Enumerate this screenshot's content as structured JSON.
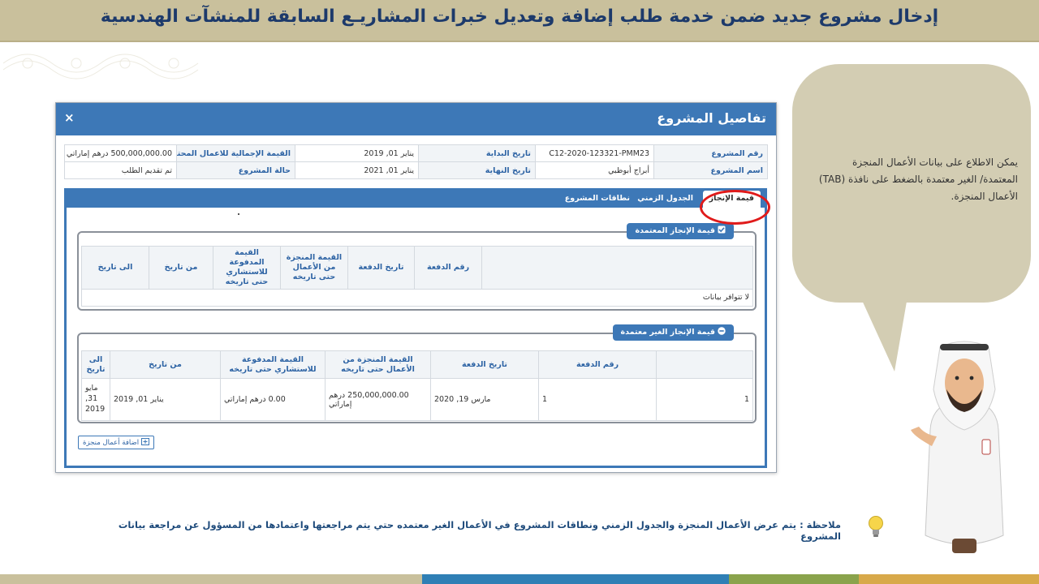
{
  "header": {
    "title": "إدخال مشروع جديد ضمن خدمة طلب إضافة وتعديل خبرات المشاريـع السابقة للمنشآت الهندسية"
  },
  "modal": {
    "title": "تفاصيل المشروع",
    "close_label": "×",
    "info": {
      "project_number_label": "رقم المشروع",
      "project_number": "C12-2020-123321-PMM23",
      "start_date_label": "تاريخ البداية",
      "start_date": "يناير 01, 2019",
      "total_value_label": "القيمة الإجمالية للاعمال المحتملة",
      "total_value": "500,000,000.00 درهم إماراتي",
      "project_name_label": "اسم المشروع",
      "project_name": "أبراج أبوظبي",
      "end_date_label": "تاريخ النهاية",
      "end_date": "يناير 01, 2021",
      "project_status_label": "حالة المشروع",
      "project_status": "تم تقديم الطلب"
    },
    "tabs": [
      {
        "label": "قيمة الإنجاز"
      },
      {
        "label": "الجدول الزمني"
      },
      {
        "label": "نطاقات المشروع"
      }
    ],
    "approved": {
      "legend": "قيمة الإنجاز المعتمدة",
      "columns": [
        "رقم الدفعة",
        "تاريخ الدفعة",
        "القيمة المنجزة من الأعمال حتى تاريخه",
        "القيمة المدفوعة للاستشاري حتى تاريخه",
        "من تاريخ",
        "الى تاريخ"
      ],
      "empty_text": "لا تتوافر بيانات"
    },
    "unapproved": {
      "legend": "قيمة الإنجاز الغير معتمدة",
      "columns": [
        "رقم الدفعة",
        "تاريخ الدفعة",
        "القيمة المنجزة من الأعمال حتى تاريخه",
        "القيمة المدفوعة للاستشاري حتى تاريخه",
        "من تاريخ",
        "الى تاريخ"
      ],
      "rows": [
        {
          "index": "1",
          "payment_no": "1",
          "payment_date": "مارس 19, 2020",
          "completed_value": "250,000,000.00 درهم إماراتي",
          "paid_value": "0.00 درهم إماراتي",
          "from_date": "يناير 01, 2019",
          "to_date": "مايو 31, 2019"
        }
      ]
    },
    "add_button": "اضافة أعمال منجزة"
  },
  "callout": {
    "text": "يمكن الاطلاع على بيانات الأعمال المنجزة المعتمدة/ الغير معتمدة بالضغط على نافذة (TAB) الأعمال المنجزة."
  },
  "note": {
    "text": "ملاحظة : يتم عرض الأعمال المنجزة والجدول الزمني ونطاقات المشروع في الأعمال الغير معتمده حتي يتم مراجعتها واعتمادها من المسؤول عن مراجعة بيانات المشروع"
  },
  "colors": {
    "header_band": "#c9c09c",
    "title_blue": "#1d3a6b",
    "modal_blue": "#3d78b7",
    "highlight_red": "#e01b1b",
    "bubble": "#d3cdb3"
  }
}
